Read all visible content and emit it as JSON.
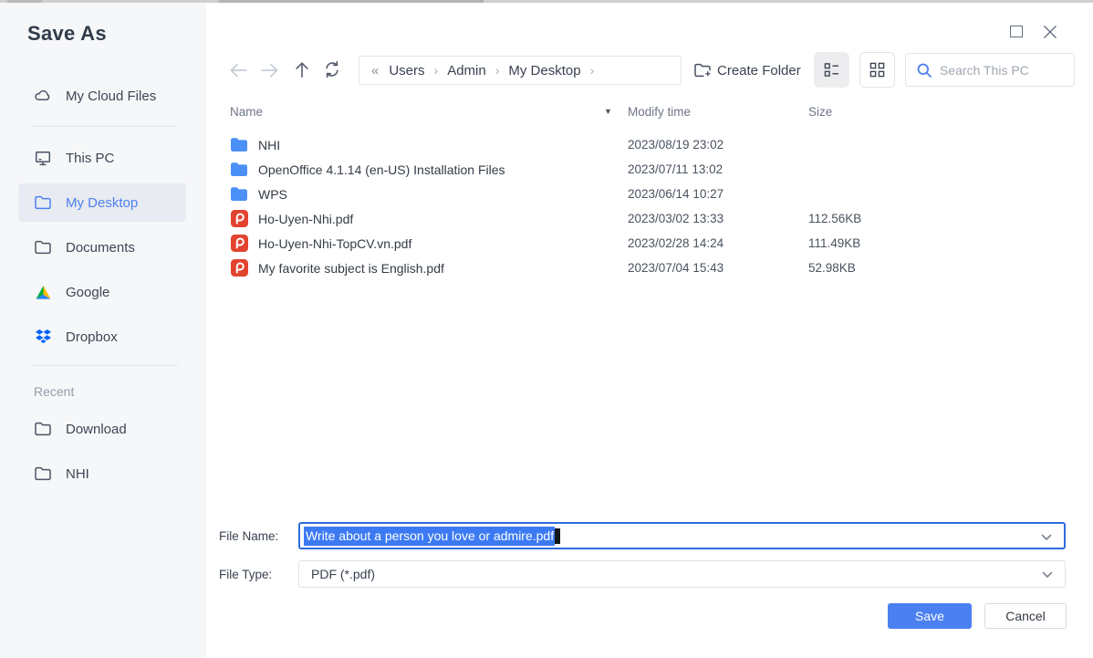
{
  "colors": {
    "accent_blue": "#4d7ff2",
    "folder_blue": "#4b90f6",
    "pdf_red": "#e2432e",
    "save_blue": "#4a80f0",
    "selection_blue": "#3c7af3",
    "sidebar_bg": "#f6f7f9",
    "sidebar_selected_bg": "#e8ebf1"
  },
  "sidebar": {
    "title": "Save As",
    "items": [
      {
        "label": "My Cloud Files",
        "icon": "cloud-icon"
      },
      {
        "label": "This PC",
        "icon": "monitor-icon"
      },
      {
        "label": "My Desktop",
        "icon": "folder-icon",
        "selected": true
      },
      {
        "label": "Documents",
        "icon": "folder-icon"
      },
      {
        "label": "Google",
        "icon": "google-drive-icon"
      },
      {
        "label": "Dropbox",
        "icon": "dropbox-icon"
      }
    ],
    "recent_label": "Recent",
    "recent_items": [
      {
        "label": "Download",
        "icon": "folder-icon"
      },
      {
        "label": "NHI",
        "icon": "folder-icon"
      }
    ]
  },
  "toolbar": {
    "breadcrumb_root": "«",
    "separator": "›",
    "breadcrumb": [
      "Users",
      "Admin",
      "My Desktop"
    ],
    "create_folder_label": "Create Folder",
    "search_placeholder": "Search This PC"
  },
  "table": {
    "columns": {
      "name": "Name",
      "modified": "Modify time",
      "size": "Size"
    },
    "sort_indicator": "▼",
    "rows": [
      {
        "type": "folder",
        "name": "NHI",
        "modified": "2023/08/19 23:02",
        "size": ""
      },
      {
        "type": "folder",
        "name": "OpenOffice 4.1.14 (en-US) Installation Files",
        "modified": "2023/07/11 13:02",
        "size": ""
      },
      {
        "type": "folder",
        "name": "WPS",
        "modified": "2023/06/14 10:27",
        "size": ""
      },
      {
        "type": "pdf",
        "name": "Ho-Uyen-Nhi.pdf",
        "modified": "2023/03/02 13:33",
        "size": "112.56KB"
      },
      {
        "type": "pdf",
        "name": "Ho-Uyen-Nhi-TopCV.vn.pdf",
        "modified": "2023/02/28 14:24",
        "size": "111.49KB"
      },
      {
        "type": "pdf",
        "name": "My favorite subject is English.pdf",
        "modified": "2023/07/04 15:43",
        "size": "52.98KB"
      }
    ]
  },
  "form": {
    "file_name_label": "File Name:",
    "file_name_value": "Write about a person you love or admire.pdf",
    "file_type_label": "File Type:",
    "file_type_value": "PDF (*.pdf)"
  },
  "actions": {
    "save_label": "Save",
    "cancel_label": "Cancel"
  }
}
